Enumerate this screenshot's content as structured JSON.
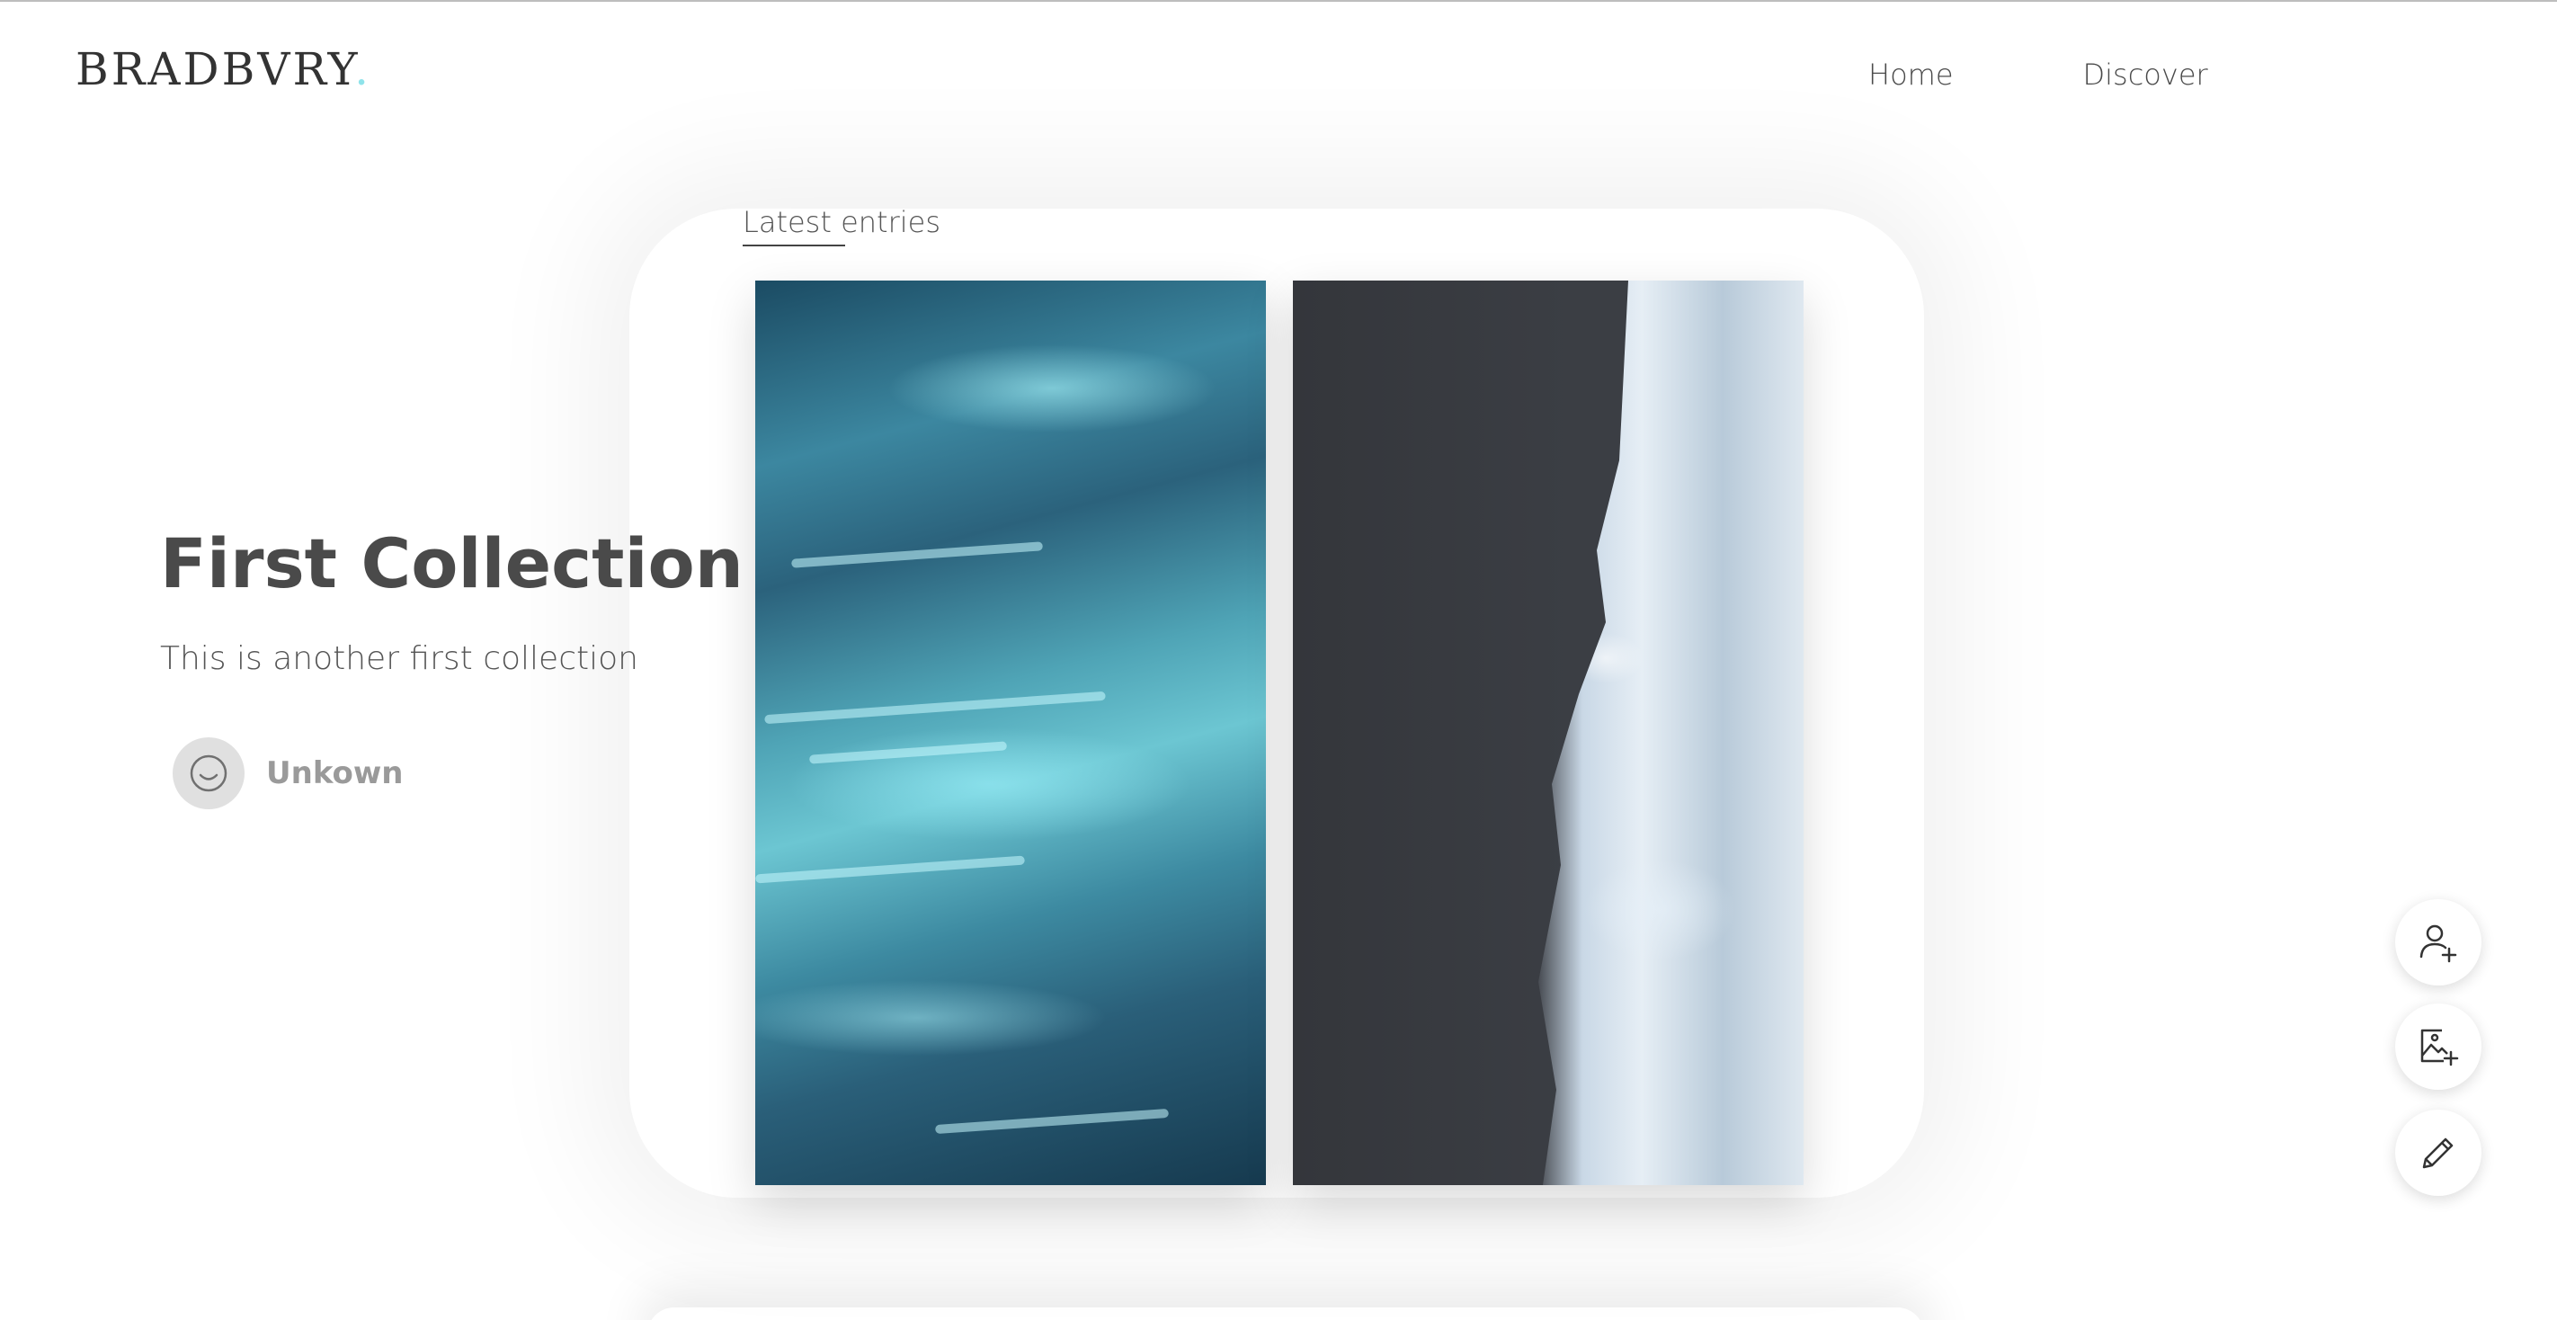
{
  "header": {
    "logo_text": "BRADBVRY",
    "logo_dot": ".",
    "nav": [
      {
        "label": "Home"
      },
      {
        "label": "Discover"
      }
    ]
  },
  "main": {
    "section_label": "Latest entries",
    "collection": {
      "title": "First Collection",
      "description": "This is another first collection",
      "author": "Unkown"
    }
  },
  "actions": [
    {
      "icon": "add-user-icon"
    },
    {
      "icon": "add-image-icon"
    },
    {
      "icon": "pencil-icon"
    }
  ],
  "colors": {
    "accent": "#8fe3ea",
    "text": "#4a4a4a",
    "muted": "#9a9a9a"
  }
}
